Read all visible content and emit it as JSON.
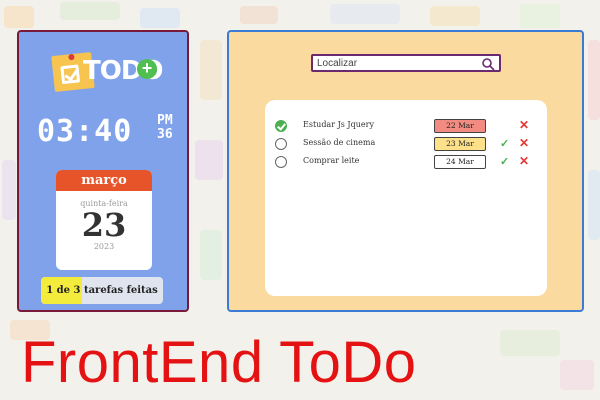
{
  "app": {
    "logo_text": "TODO",
    "title": "FrontEnd ToDo"
  },
  "clock": {
    "time": "03:40",
    "ampm_line1": "PM",
    "ampm_line2": "36"
  },
  "calendar": {
    "month": "março",
    "weekday": "quinta-feira",
    "day": "23",
    "year": "2023"
  },
  "counter": {
    "text": "1 de 3 tarefas feitas",
    "progress": 0.3333
  },
  "search": {
    "placeholder": "Localizar",
    "icon": "search-icon"
  },
  "tasks": [
    {
      "label": "Estudar Js Jquery",
      "date": "22 Mar",
      "done": true,
      "date_color": "#f28b82"
    },
    {
      "label": "Sessão de cinema",
      "date": "23 Mar",
      "done": false,
      "date_color": "#fde08a"
    },
    {
      "label": "Comprar leite",
      "date": "24 Mar",
      "done": false,
      "date_color": "#ffffff"
    }
  ],
  "colors": {
    "left_panel": "#6e96eb",
    "right_panel": "#fbd48e",
    "title": "#e41212"
  }
}
